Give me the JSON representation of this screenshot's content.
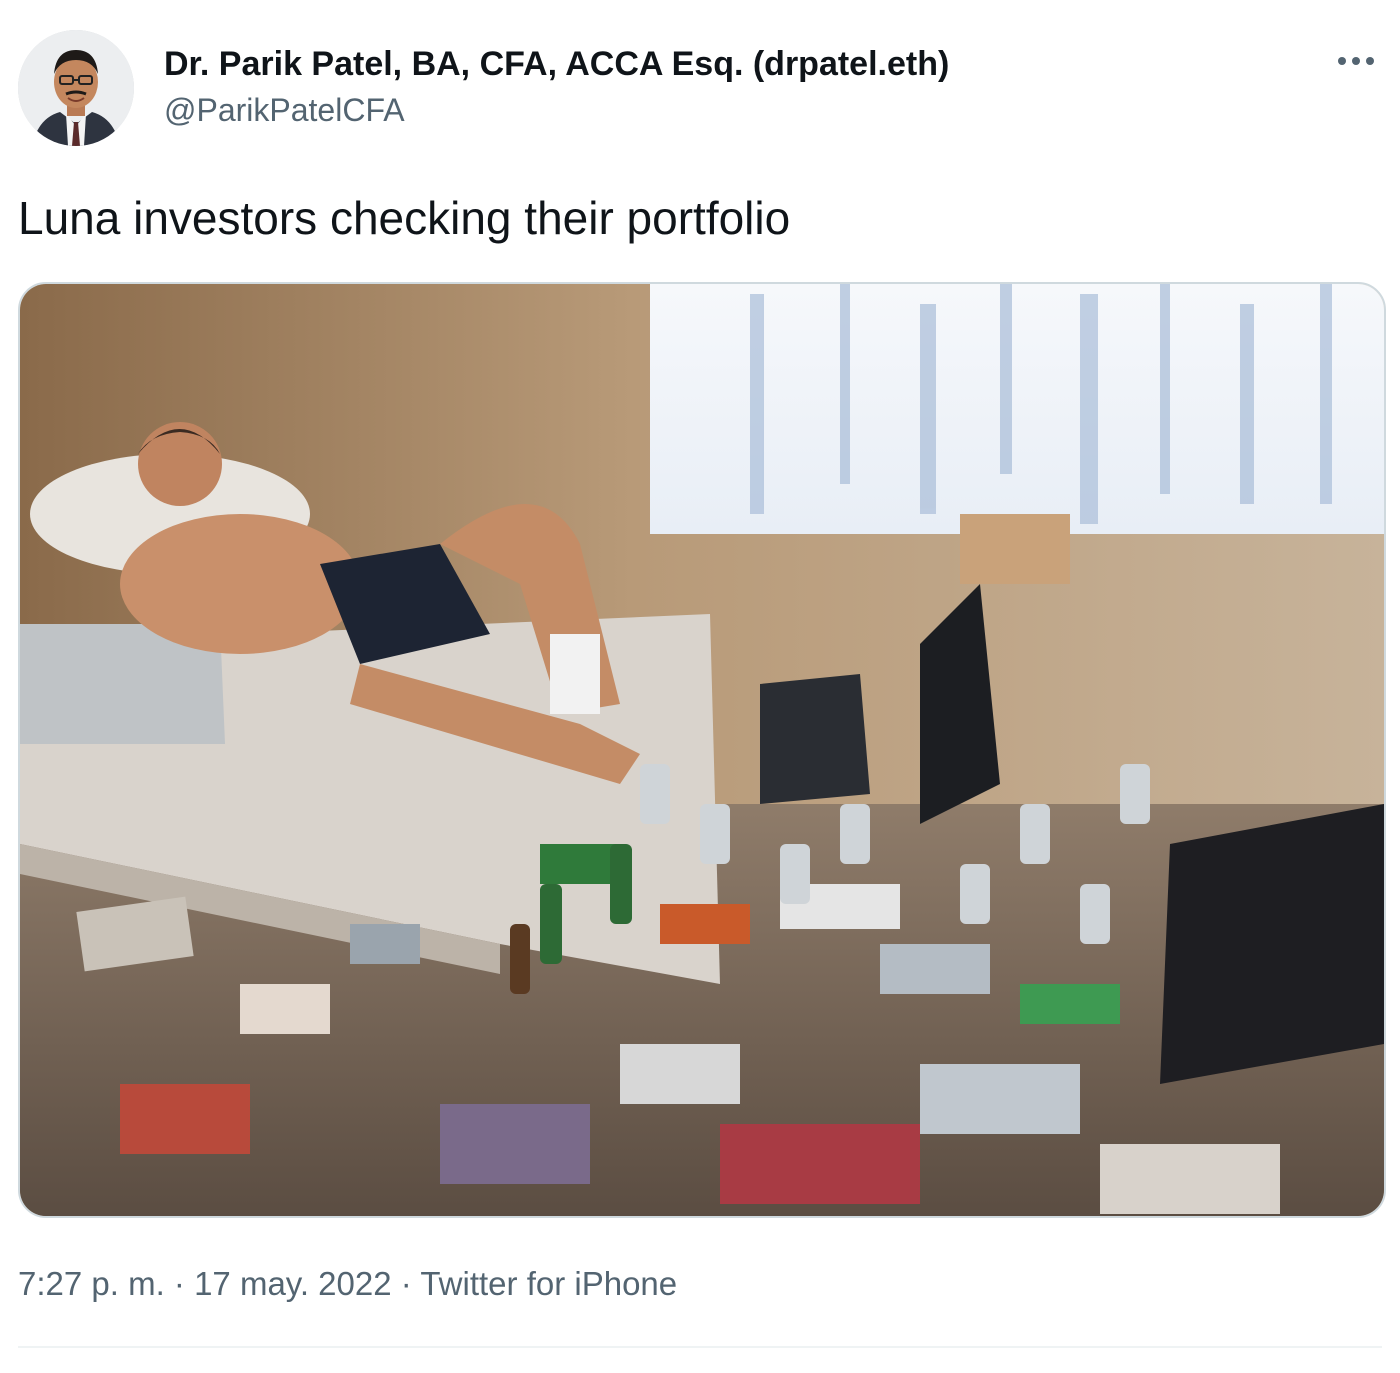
{
  "author": {
    "display_name": "Dr. Parik Patel, BA, CFA, ACCA Esq. (drpatel.eth)",
    "handle": "@ParikPatelCFA",
    "avatar_icon": "person-avatar"
  },
  "menu": {
    "more_icon": "more-horizontal-icon"
  },
  "tweet": {
    "text": "Luna investors checking their portfolio"
  },
  "meta": {
    "time": "7:27 p. m.",
    "separator1": " · ",
    "date": "17 may. 2022",
    "separator2": " · ",
    "source": "Twitter for iPhone"
  },
  "colors": {
    "text_primary": "#0f1419",
    "text_secondary": "#536471",
    "border": "#cfd9de",
    "divider": "#eff3f4"
  }
}
